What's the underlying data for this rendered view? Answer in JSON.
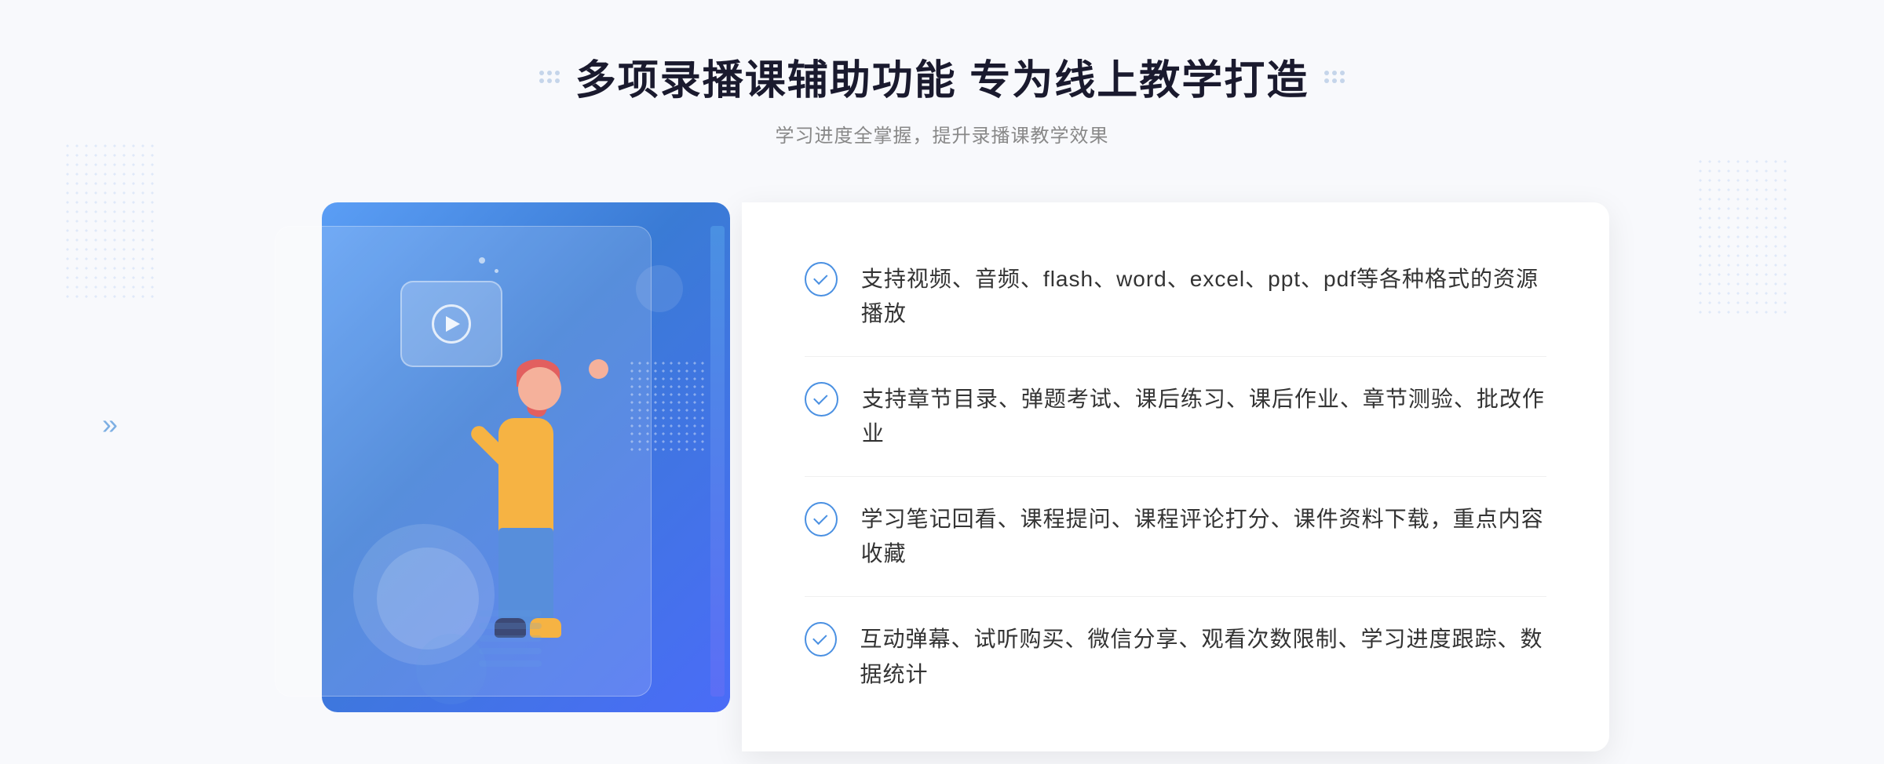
{
  "page": {
    "background_color": "#f8f9fc"
  },
  "header": {
    "title": "多项录播课辅助功能 专为线上教学打造",
    "subtitle": "学习进度全掌握，提升录播课教学效果",
    "title_dots_left": "dots-left",
    "title_dots_right": "dots-right"
  },
  "features": [
    {
      "id": 1,
      "text": "支持视频、音频、flash、word、excel、ppt、pdf等各种格式的资源播放"
    },
    {
      "id": 2,
      "text": "支持章节目录、弹题考试、课后练习、课后作业、章节测验、批改作业"
    },
    {
      "id": 3,
      "text": "学习笔记回看、课程提问、课程评论打分、课件资料下载，重点内容收藏"
    },
    {
      "id": 4,
      "text": "互动弹幕、试听购买、微信分享、观看次数限制、学习进度跟踪、数据统计"
    }
  ],
  "decorative": {
    "arrow_left": "»",
    "play_icon": "▶",
    "check_icon": "✓"
  },
  "colors": {
    "primary_blue": "#4a90e2",
    "gradient_start": "#5b9ef5",
    "gradient_end": "#4a6cf7",
    "text_dark": "#333333",
    "text_light": "#888888",
    "title_color": "#1a1a2e",
    "accent_bar": "#4a90e2"
  }
}
